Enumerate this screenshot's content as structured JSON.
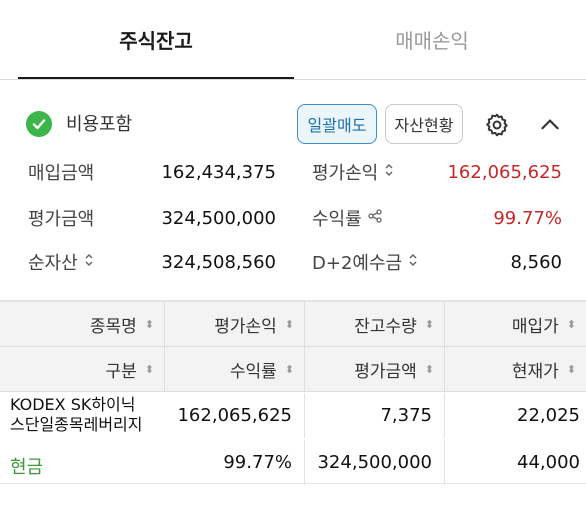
{
  "tabs": {
    "holdings": "주식잔고",
    "trades": "매매손익"
  },
  "toolbar": {
    "fee_label": "비용포함",
    "sell_all": "일괄매도",
    "asset_status": "자산현황"
  },
  "summary": {
    "purchase_label": "매입금액",
    "purchase_value": "162,434,375",
    "pl_label": "평가손익",
    "pl_value": "162,065,625",
    "eval_label": "평가금액",
    "eval_value": "324,500,000",
    "return_label": "수익률",
    "return_value": "99.77%",
    "net_label": "순자산",
    "net_value": "324,508,560",
    "deposit_label": "D+2예수금",
    "deposit_value": "8,560"
  },
  "table": {
    "headers_row1": [
      "종목명",
      "평가손익",
      "잔고수량",
      "매입가"
    ],
    "headers_row2": [
      "구분",
      "수익률",
      "평가금액",
      "현재가"
    ],
    "row": {
      "name_line1": "KODEX SK하이닉",
      "name_line2": "스단일종목레버리지",
      "type": "현금",
      "pl": "162,065,625",
      "return": "99.77%",
      "qty": "7,375",
      "eval": "324,500,000",
      "buy_price": "22,025",
      "current_price": "44,000"
    }
  },
  "colors": {
    "positive": "#c62828",
    "accent": "#3a8fc9",
    "check": "#3cb54a",
    "cash": "#3a9a3a"
  },
  "icons": [
    "check-circle-icon",
    "gear-icon",
    "chevron-up-icon",
    "sort-updown-icon",
    "share-icon",
    "sort-arrows-icon"
  ]
}
